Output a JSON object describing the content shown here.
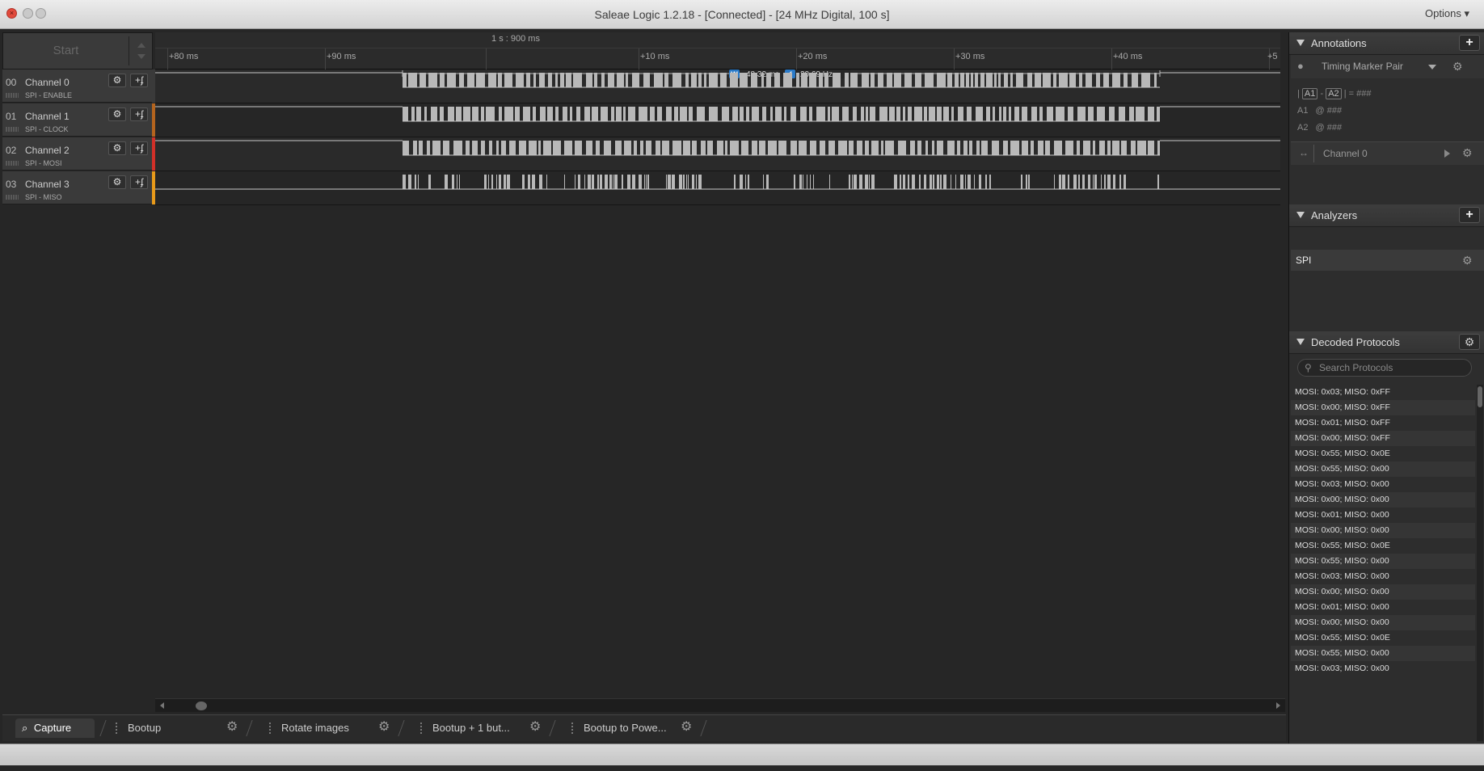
{
  "window": {
    "title": "Saleae Logic 1.2.18 - [Connected] - [24 MHz Digital, 100 s]",
    "options_label": "Options ▾"
  },
  "toolbar": {
    "start_label": "Start"
  },
  "timeline": {
    "center_label": "1 s : 900 ms",
    "ticks": [
      "+80 ms",
      "+90 ms",
      "+10 ms",
      "+20 ms",
      "+30 ms",
      "+40 ms",
      "+5"
    ],
    "measure_width": "48.32 ms",
    "measure_freq": "20.69 Hz",
    "measure_w_badge": "W",
    "measure_f_badge": "f"
  },
  "channels": [
    {
      "num": "00",
      "name": "Channel 0",
      "sub": "SPI - ENABLE",
      "color": "#3a3a3a"
    },
    {
      "num": "01",
      "name": "Channel 1",
      "sub": "SPI - CLOCK",
      "color": "#b4641e"
    },
    {
      "num": "02",
      "name": "Channel 2",
      "sub": "SPI - MOSI",
      "color": "#d23028"
    },
    {
      "num": "03",
      "name": "Channel 3",
      "sub": "SPI - MISO",
      "color": "#e89a1a"
    }
  ],
  "tabs": [
    {
      "label": "Capture"
    },
    {
      "label": "Bootup"
    },
    {
      "label": "Rotate images"
    },
    {
      "label": "Bootup + 1 but..."
    },
    {
      "label": "Bootup to Powe..."
    }
  ],
  "annotations": {
    "header": "Annotations",
    "marker_pair_label": "Timing Marker Pair",
    "diff_a1": "A1",
    "diff_minus": "-",
    "diff_a2": "A2",
    "diff_eq": "= ###",
    "a1_label": "A1",
    "a1_value": "@  ###",
    "a2_label": "A2",
    "a2_value": "@  ###",
    "channel_label": "Channel 0"
  },
  "analyzers": {
    "header": "Analyzers",
    "items": [
      "SPI"
    ]
  },
  "decoded": {
    "header": "Decoded Protocols",
    "search_placeholder": "Search Protocols",
    "rows": [
      "MOSI: 0x03;  MISO: 0xFF",
      "MOSI: 0x00;  MISO: 0xFF",
      "MOSI: 0x01;  MISO: 0xFF",
      "MOSI: 0x00;  MISO: 0xFF",
      "MOSI: 0x55;  MISO: 0x0E",
      "MOSI: 0x55;  MISO: 0x00",
      "MOSI: 0x03;  MISO: 0x00",
      "MOSI: 0x00;  MISO: 0x00",
      "MOSI: 0x01;  MISO: 0x00",
      "MOSI: 0x00;  MISO: 0x00",
      "MOSI: 0x55;  MISO: 0x0E",
      "MOSI: 0x55;  MISO: 0x00",
      "MOSI: 0x03;  MISO: 0x00",
      "MOSI: 0x00;  MISO: 0x00",
      "MOSI: 0x01;  MISO: 0x00",
      "MOSI: 0x00;  MISO: 0x00",
      "MOSI: 0x55;  MISO: 0x0E",
      "MOSI: 0x55;  MISO: 0x00",
      "MOSI: 0x03;  MISO: 0x00"
    ]
  },
  "icons": {
    "close": "close-icon",
    "minimize": "minimize-icon",
    "maximize": "maximize-icon",
    "gear": "gear-icon",
    "trigger": "trigger-icon",
    "search": "search-icon",
    "pin": "pin-icon",
    "plus": "plus-icon"
  }
}
